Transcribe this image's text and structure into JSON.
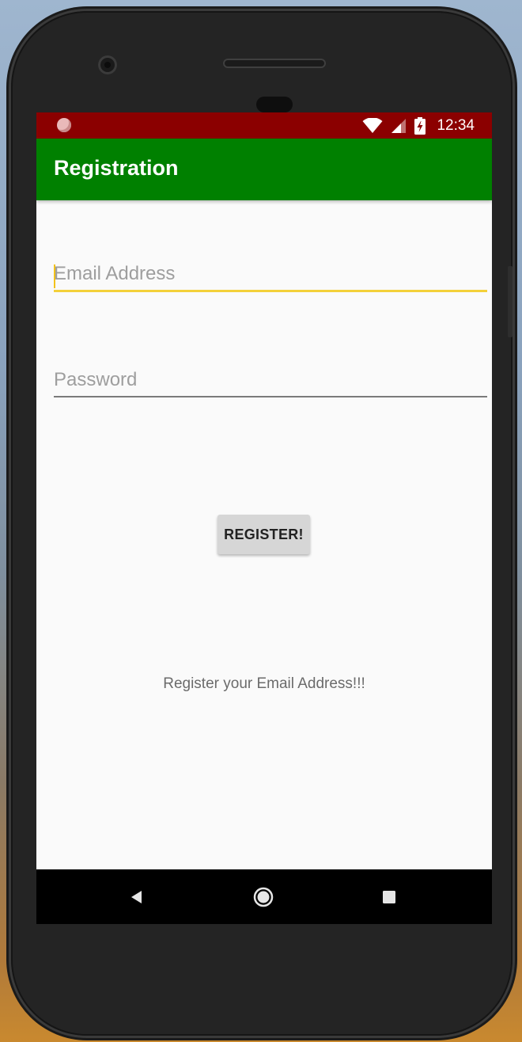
{
  "status_bar": {
    "time": "12:34",
    "color": "#8b0000",
    "icons": [
      "record-icon",
      "wifi-icon",
      "signal-icon",
      "battery-charging-icon"
    ]
  },
  "app_bar": {
    "title": "Registration",
    "color": "#008000"
  },
  "form": {
    "email": {
      "placeholder": "Email Address",
      "value": "",
      "accent_color": "#f3d03a"
    },
    "password": {
      "placeholder": "Password",
      "value": ""
    },
    "register_button_label": "REGISTER!"
  },
  "message": "Register your Email Address!!!",
  "nav_bar": {
    "icons": [
      "back-icon",
      "home-icon",
      "recents-icon"
    ]
  }
}
